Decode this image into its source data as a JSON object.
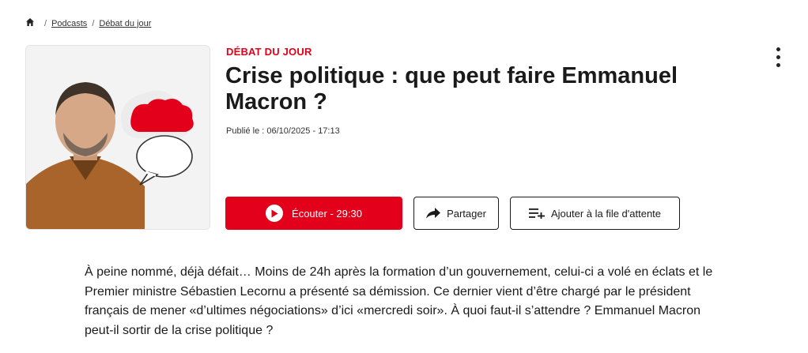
{
  "breadcrumb": {
    "home_icon": "home-icon",
    "separator": "/",
    "items": [
      "Podcasts",
      "Débat du jour"
    ]
  },
  "episode": {
    "kicker": "DÉBAT DU JOUR",
    "title": "Crise politique : que peut faire Emmanuel Macron ?",
    "published": "Publié le : 06/10/2025 - 17:13",
    "description": "À peine nommé, déjà défait… Moins de 24h après la formation d’un gouvernement, celui-ci a volé en éclats et le Premier ministre Sébastien Lecornu a présenté sa démission. Ce dernier vient d’être chargé par le président français de mener «d’ultimes négociations» d’ici «mercredi soir». À quoi faut-il s’attendre ? Emmanuel Macron peut-il sortir de la crise politique ?"
  },
  "actions": {
    "listen_label": "Écouter - 29:30",
    "share_label": "Partager",
    "queue_label": "Ajouter à la file d'attente",
    "more_icon": "more-vertical-icon"
  },
  "colors": {
    "brand_red": "#e2001a",
    "text": "#1a1a1a"
  }
}
